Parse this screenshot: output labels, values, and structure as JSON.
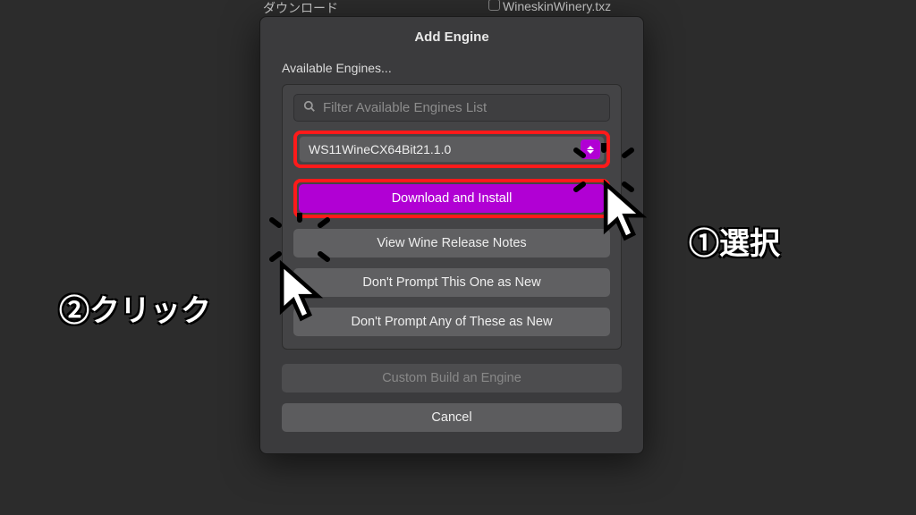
{
  "modal": {
    "title": "Add Engine",
    "sectionLabel": "Available Engines...",
    "search": {
      "placeholder": "Filter Available Engines List"
    },
    "select": {
      "value": "WS11WineCX64Bit21.1.0"
    },
    "buttons": {
      "download": "Download and Install",
      "releaseNotes": "View Wine Release Notes",
      "dontPromptOne": "Don't Prompt This One as New",
      "dontPromptAny": "Don't Prompt Any of These as New",
      "customBuild": "Custom Build an Engine",
      "cancel": "Cancel"
    }
  },
  "annotations": {
    "step1": "①選択",
    "step2": "②クリック"
  },
  "background": {
    "topLeft": "ダウンロード",
    "topRight": "WineskinWinery.txz"
  }
}
